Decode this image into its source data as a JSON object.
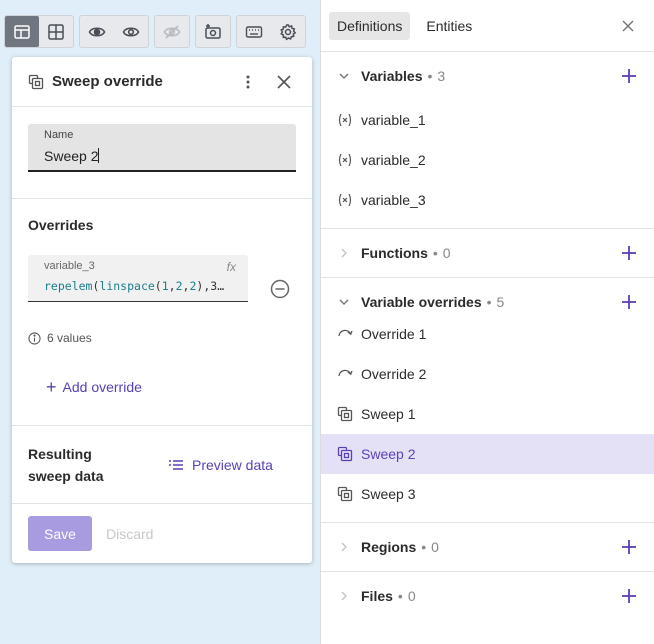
{
  "toolbar": {
    "buttons": [
      {
        "icon": "layout-list-icon",
        "active": true
      },
      {
        "icon": "grid-icon"
      },
      {
        "icon": "eye-show-icon"
      },
      {
        "icon": "eye-icon"
      },
      {
        "icon": "eye-off-icon",
        "disabled": true
      },
      {
        "icon": "camera-add-icon"
      },
      {
        "icon": "keyboard-icon"
      },
      {
        "icon": "gear-icon"
      }
    ]
  },
  "panel": {
    "title": "Sweep override",
    "name_label": "Name",
    "name_value": "Sweep 2",
    "overrides_title": "Overrides",
    "override": {
      "variable": "variable_3",
      "fx": "fx",
      "expr_fn1": "repelem",
      "expr_fn2": "linspace",
      "expr_nums": [
        "1",
        "2",
        "2"
      ],
      "expr_tail": ",3…"
    },
    "info_text": "6 values",
    "add_override": "Add override",
    "result_title_line1": "Resulting",
    "result_title_line2": "sweep data",
    "preview": "Preview data",
    "save": "Save",
    "discard": "Discard"
  },
  "sidebar": {
    "tabs": [
      "Definitions",
      "Entities"
    ],
    "groups": {
      "variables": {
        "name": "Variables",
        "count": "3",
        "items": [
          "variable_1",
          "variable_2",
          "variable_3"
        ]
      },
      "functions": {
        "name": "Functions",
        "count": "0"
      },
      "variable_overrides": {
        "name": "Variable overrides",
        "count": "5",
        "items": [
          "Override 1",
          "Override 2",
          "Sweep 1",
          "Sweep 2",
          "Sweep 3"
        ]
      },
      "regions": {
        "name": "Regions",
        "count": "0"
      },
      "files": {
        "name": "Files",
        "count": "0"
      }
    }
  },
  "colors": {
    "accent": "#5b3fb5",
    "selected_row": "#e4e1f7",
    "canvas": "#dfeef8"
  }
}
